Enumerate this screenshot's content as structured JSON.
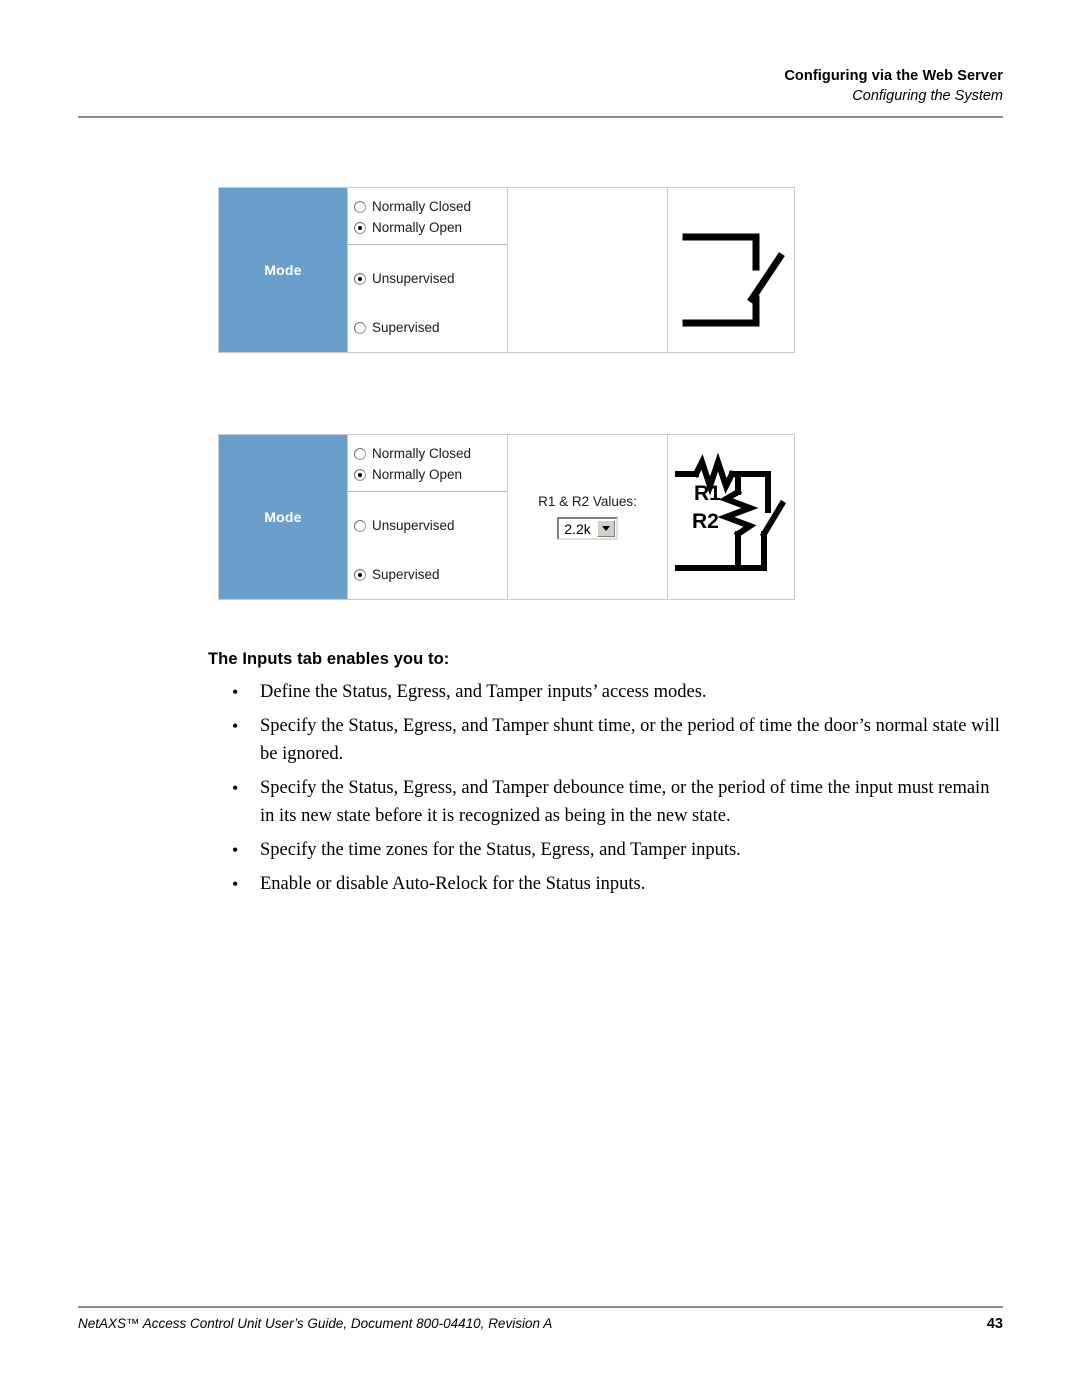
{
  "header": {
    "title": "Configuring via the Web Server",
    "subtitle": "Configuring the System"
  },
  "figures": [
    {
      "id": "unsupervised-mode-figure",
      "mode_label": "Mode",
      "radio_groups": [
        {
          "options": [
            {
              "label": "Normally Closed",
              "checked": false
            },
            {
              "label": "Normally Open",
              "checked": true
            }
          ]
        },
        {
          "options": [
            {
              "label": "Unsupervised",
              "checked": true
            },
            {
              "label": "Supervised",
              "checked": false
            }
          ]
        }
      ],
      "values_panel": {
        "visible": false,
        "label": "",
        "selected": ""
      },
      "circuit": "open-switch-diagram"
    },
    {
      "id": "supervised-mode-figure",
      "mode_label": "Mode",
      "radio_groups": [
        {
          "options": [
            {
              "label": "Normally Closed",
              "checked": false
            },
            {
              "label": "Normally Open",
              "checked": true
            }
          ]
        },
        {
          "options": [
            {
              "label": "Unsupervised",
              "checked": false
            },
            {
              "label": "Supervised",
              "checked": true
            }
          ]
        }
      ],
      "values_panel": {
        "visible": true,
        "label": "R1 & R2 Values:",
        "selected": "2.2k"
      },
      "circuit": "supervised-resistor-switch-diagram",
      "circuit_labels": {
        "r1": "R1",
        "r2": "R2"
      }
    }
  ],
  "body": {
    "heading": "The Inputs tab enables you to:",
    "bullet_marker": "•",
    "bullets": [
      "Define the Status, Egress, and Tamper inputs’ access modes.",
      "Specify the Status, Egress, and Tamper shunt time, or the period of time the door’s normal state will be ignored.",
      "Specify the Status, Egress, and Tamper debounce time, or the period of time the input must remain in its new state before it is recognized as being in the new state.",
      "Specify the time zones for the Status, Egress, and Tamper inputs.",
      "Enable or disable Auto-Relock for the Status inputs."
    ]
  },
  "footer": {
    "text": "NetAXS™ Access Control Unit User’s Guide, Document 800-04410, Revision A",
    "page_number": "43"
  },
  "colors": {
    "mode_cell_blue": "#6a9fcc",
    "rule_gray": "#8c8c8c",
    "table_border": "#c9c9c9"
  }
}
